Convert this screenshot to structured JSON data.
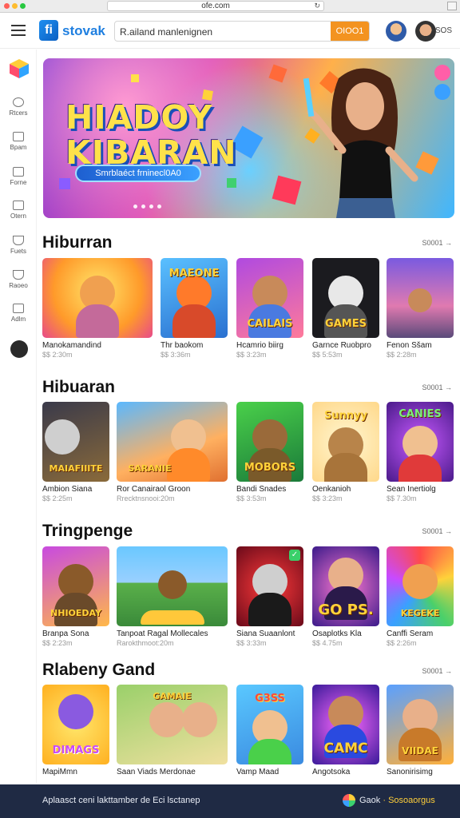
{
  "browser": {
    "url": "ofe.com"
  },
  "header": {
    "logo_mark": "fi",
    "logo_text": "stovak",
    "search_placeholder": "R.ailand manlenignen",
    "search_button": "OIOO1",
    "account_label": "SOS"
  },
  "sidebar": {
    "items": [
      {
        "label": "Rtcers",
        "icon": "clock-icon"
      },
      {
        "label": "Bpam",
        "icon": "image-icon"
      },
      {
        "label": "Forne",
        "icon": "home-icon"
      },
      {
        "label": "Otern",
        "icon": "calendar-icon"
      },
      {
        "label": "Fuets",
        "icon": "send-icon"
      },
      {
        "label": "Raoeo",
        "icon": "paper-plane-icon"
      },
      {
        "label": "Adlm",
        "icon": "document-icon"
      }
    ]
  },
  "hero": {
    "title_line1": "HIADOY",
    "title_line2": "KIBARAN",
    "pill": "Smrblaéct frninecl0A0"
  },
  "sections": [
    {
      "title": "Hiburran",
      "more": "S0001 →",
      "cards": [
        {
          "title": "Manokamandind",
          "sub": "$$ 2:30m",
          "label": ""
        },
        {
          "title": "Thr baokom",
          "sub": "$$ 3:36m",
          "label": "MAEONE"
        },
        {
          "title": "Hcamrio biirg",
          "sub": "$$ 3:23m",
          "label": "CAILAIS"
        },
        {
          "title": "Garnce Ruobpro",
          "sub": "$$ 5:53m",
          "label": "GAMES"
        },
        {
          "title": "Fenon Sšam",
          "sub": "$$ 2:28m",
          "label": ""
        }
      ]
    },
    {
      "title": "Hibuaran",
      "more": "S0001 →",
      "cards": [
        {
          "title": "Ambion Siana",
          "sub": "$$ 2:25m",
          "label": "MAIAFIIITE"
        },
        {
          "title": "Ror Canairaol Groon",
          "sub": "Rrecktnsnooi:20m",
          "label": "SARANIE"
        },
        {
          "title": "Bandi Snades",
          "sub": "$$ 3:53m",
          "label": "MOBORS"
        },
        {
          "title": "Oenkanioh",
          "sub": "$$ 3:23m",
          "label": "Sunnyy"
        },
        {
          "title": "Sean Inertiolg",
          "sub": "$$ 7.30m",
          "label": "CANIES"
        }
      ]
    },
    {
      "title": "Tringpenge",
      "more": "S0001 →",
      "cards": [
        {
          "title": "Branpa Sona",
          "sub": "$$ 2:23m",
          "label": "NHIOEDAY"
        },
        {
          "title": "Tanpoat Ragal Mollecales",
          "sub": "Rarokthmoot:20m",
          "label": ""
        },
        {
          "title": "Siana Suaanlont",
          "sub": "$$ 3:33m",
          "label": ""
        },
        {
          "title": "Osaplotks Kla",
          "sub": "$$ 4.75m",
          "label": "GO PS."
        },
        {
          "title": "Canffi Seram",
          "sub": "$$ 2:26m",
          "label": "KEGEKE"
        }
      ]
    },
    {
      "title": "Rlabeny Gand",
      "more": "S0001 →",
      "cards": [
        {
          "title": "MapiMmn",
          "sub": "",
          "label": "DIMAGS"
        },
        {
          "title": "Saan Viads Merdonae",
          "sub": "",
          "label": "GAMAIE"
        },
        {
          "title": "Vamp Maad",
          "sub": "",
          "label": "G3SS"
        },
        {
          "title": "Angotsoka",
          "sub": "",
          "label": "CAMC"
        },
        {
          "title": "Sanonirisimg",
          "sub": "",
          "label": "VIIDAE"
        }
      ]
    }
  ],
  "footer": {
    "text": "Aplaasct ceni lakttamber de Eci lsctanep",
    "right_label": "Gaok",
    "right_link": "· Sosoaorgus"
  },
  "colors": {
    "accent": "#f39320",
    "brand": "#1f7fe0",
    "footer_bg": "#1f2a44"
  }
}
